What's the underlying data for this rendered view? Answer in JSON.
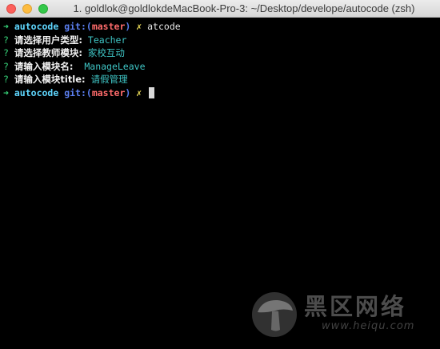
{
  "window": {
    "title": "1. goldlok@goldlokdeMacBook-Pro-3: ~/Desktop/develope/autocode (zsh)"
  },
  "terminal": {
    "prompt": {
      "arrow": "➜",
      "dir": "autocode",
      "git_label": "git:(",
      "branch": "master",
      "git_close": ")",
      "dirty_mark": "✗"
    },
    "command": "atcode",
    "questions": [
      {
        "mark": "?",
        "label": "请选择用户类型:",
        "answer": "Teacher"
      },
      {
        "mark": "?",
        "label": "请选择教师模块:",
        "answer": "家校互动"
      },
      {
        "mark": "?",
        "label": "请输入模块名:",
        "answer": " ManageLeave"
      },
      {
        "mark": "?",
        "label": "请输入模块title:",
        "answer": "请假管理"
      }
    ]
  },
  "watermark": {
    "text": "黑区网络",
    "url": "www.heiqu.com"
  },
  "colors": {
    "background": "#000000",
    "arrow": "#37d67a",
    "dir": "#5fd7ff",
    "git": "#5b7ff0",
    "branch": "#ff6b6b",
    "dirty": "#f0e05a",
    "answer": "#3fc6c6"
  }
}
